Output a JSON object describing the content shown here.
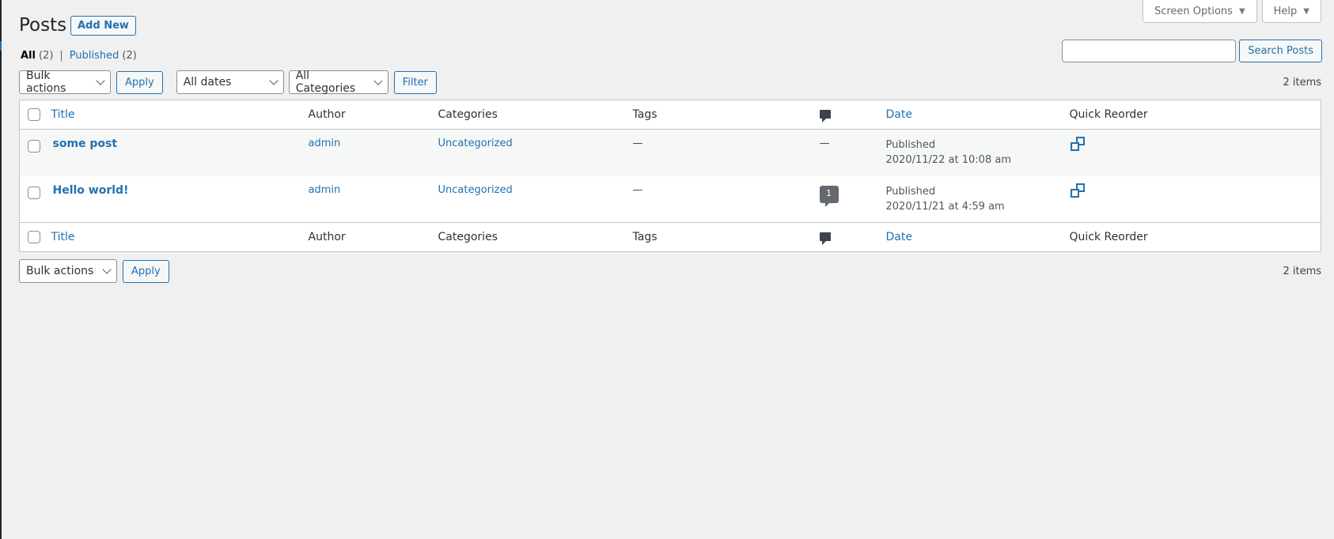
{
  "screen_meta": {
    "screen_options": "Screen Options",
    "help": "Help",
    "caret": "▼"
  },
  "header": {
    "title": "Posts",
    "add_new": "Add New"
  },
  "views": {
    "all_label": "All",
    "all_count": "(2)",
    "separator": "|",
    "published_label": "Published",
    "published_count": "(2)"
  },
  "search": {
    "button": "Search Posts",
    "value": ""
  },
  "tablenav_top": {
    "bulk_actions": "Bulk actions",
    "apply": "Apply",
    "dates": "All dates",
    "categories": "All Categories",
    "filter": "Filter",
    "items": "2 items"
  },
  "tablenav_bottom": {
    "bulk_actions": "Bulk actions",
    "apply": "Apply",
    "items": "2 items"
  },
  "columns": {
    "title": "Title",
    "author": "Author",
    "categories": "Categories",
    "tags": "Tags",
    "date": "Date",
    "quick_reorder": "Quick Reorder"
  },
  "rows": [
    {
      "title": "some post",
      "author": "admin",
      "categories": "Uncategorized",
      "tags": "—",
      "comments": "—",
      "status": "Published",
      "date": "2020/11/22 at 10:08 am"
    },
    {
      "title": "Hello world!",
      "author": "admin",
      "categories": "Uncategorized",
      "tags": "—",
      "comments": "1",
      "status": "Published",
      "date": "2020/11/21 at 4:59 am"
    }
  ],
  "colors": {
    "link": "#2271b1",
    "background": "#f0f0f1",
    "text": "#3c434a"
  }
}
